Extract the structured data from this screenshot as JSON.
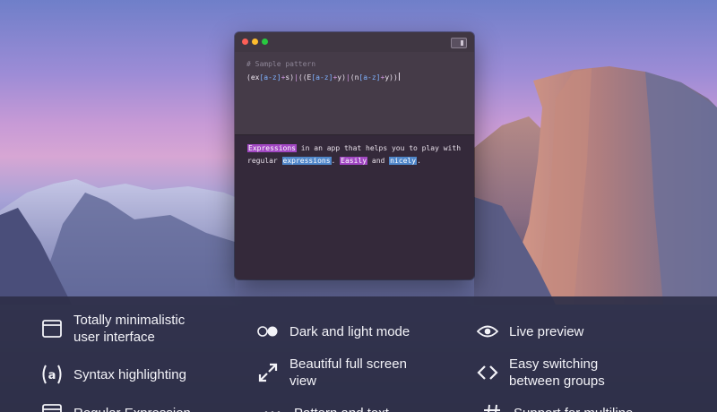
{
  "editor": {
    "comment": "# Sample pattern",
    "pattern_tokens": [
      {
        "t": "(",
        "c": "tok-paren"
      },
      {
        "t": "ex",
        "c": "tok-lit"
      },
      {
        "t": "[a-z]",
        "c": "tok-class"
      },
      {
        "t": "+",
        "c": "tok-quant"
      },
      {
        "t": "s",
        "c": "tok-lit"
      },
      {
        "t": ")",
        "c": "tok-paren"
      },
      {
        "t": "|",
        "c": "tok-quant"
      },
      {
        "t": "((",
        "c": "tok-paren"
      },
      {
        "t": "E",
        "c": "tok-lit"
      },
      {
        "t": "[a-z]",
        "c": "tok-class"
      },
      {
        "t": "+",
        "c": "tok-quant"
      },
      {
        "t": "y",
        "c": "tok-lit"
      },
      {
        "t": ")",
        "c": "tok-paren"
      },
      {
        "t": "|",
        "c": "tok-quant"
      },
      {
        "t": "(",
        "c": "tok-paren"
      },
      {
        "t": "n",
        "c": "tok-lit"
      },
      {
        "t": "[a-z]",
        "c": "tok-class"
      },
      {
        "t": "+",
        "c": "tok-quant"
      },
      {
        "t": "y",
        "c": "tok-lit"
      },
      {
        "t": "))",
        "c": "tok-paren"
      }
    ],
    "sample_text": {
      "line1": [
        {
          "t": "Expressions",
          "hl": "purple"
        },
        {
          "t": " in an app that helps you to play with",
          "hl": ""
        }
      ],
      "line2": [
        {
          "t": "regular ",
          "hl": ""
        },
        {
          "t": "expressions",
          "hl": "blue"
        },
        {
          "t": ". ",
          "hl": ""
        },
        {
          "t": "Easily",
          "hl": "purple"
        },
        {
          "t": " and ",
          "hl": ""
        },
        {
          "t": "nicely",
          "hl": "blue"
        },
        {
          "t": ".",
          "hl": ""
        }
      ]
    }
  },
  "features": [
    {
      "name": "feature-minimalistic-ui",
      "icon": "window-icon",
      "text": "Totally minimalistic\nuser interface"
    },
    {
      "name": "feature-dark-light-mode",
      "icon": "toggle-icon",
      "text": "Dark and light mode"
    },
    {
      "name": "feature-live-preview",
      "icon": "eye-icon",
      "text": "Live preview"
    },
    {
      "name": "feature-syntax-highlighting",
      "icon": "at-icon",
      "text": "Syntax highlighting"
    },
    {
      "name": "feature-full-screen",
      "icon": "expand-icon",
      "text": "Beautiful full screen\nview"
    },
    {
      "name": "feature-group-switching",
      "icon": "code-brackets-icon",
      "text": "Easy switching\nbetween groups"
    },
    {
      "name": "feature-regular-expression",
      "icon": "window-icon",
      "text": "Regular Expression"
    },
    {
      "name": "feature-pattern-text",
      "icon": "dots-icon",
      "text": "Pattern and text"
    },
    {
      "name": "feature-multiline",
      "icon": "hash-icon",
      "text": "Support for multiline"
    }
  ],
  "colors": {
    "highlight_purple": "#a147c2",
    "highlight_blue": "#4f86c9",
    "feature_bar": "#2e2f48"
  }
}
